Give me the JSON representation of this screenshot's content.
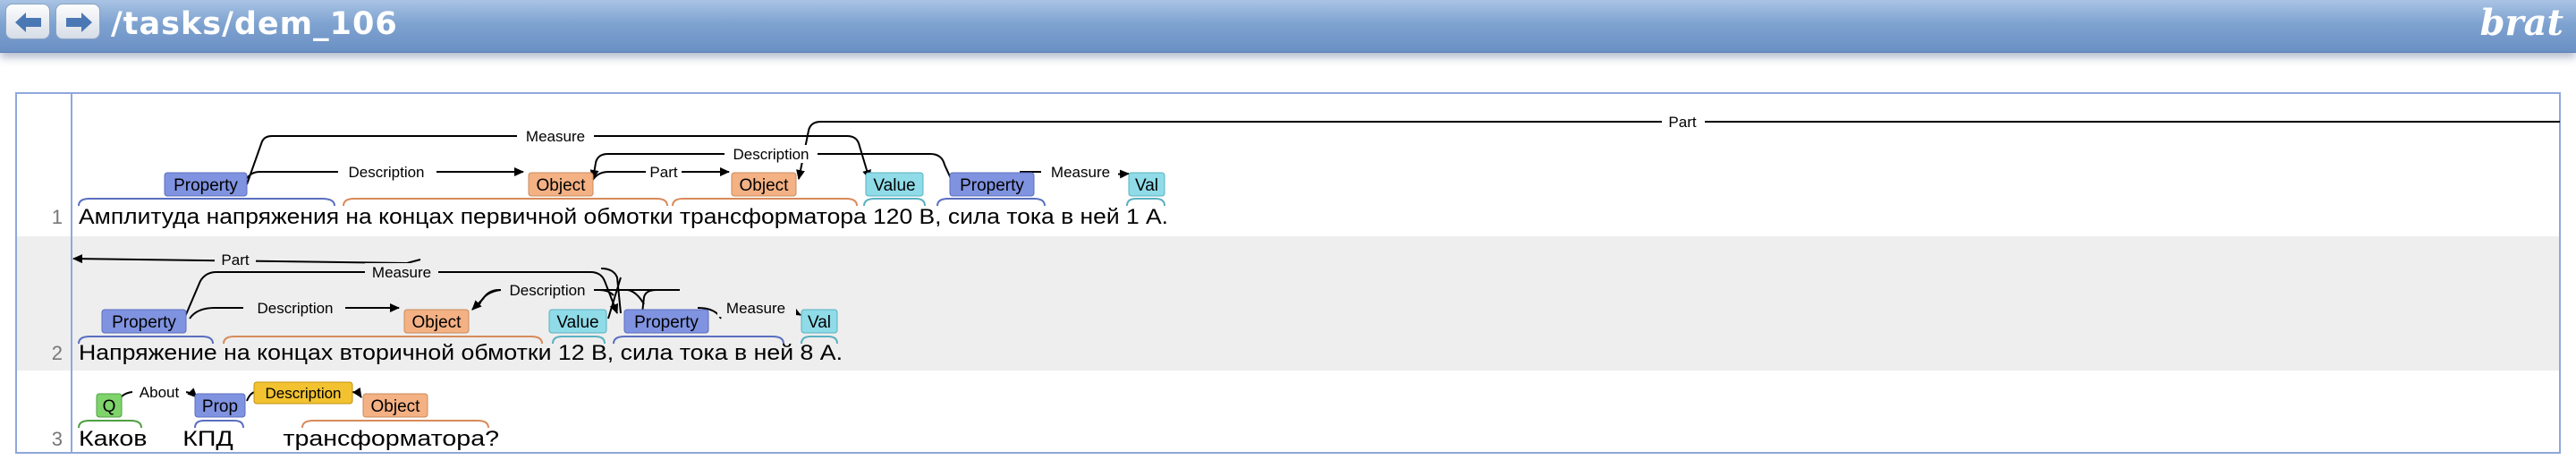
{
  "header": {
    "back_label": "",
    "forward_label": "",
    "doc_path": "/tasks/dem_106",
    "logo": "brat"
  },
  "sentences": [
    {
      "number": "1",
      "text": "Амплитуда напряжения на концах первичной обмотки трансформатора 120 В, сила тока в ней  1 А.",
      "entities": [
        {
          "type": "Property",
          "color": "#7f93e0",
          "covers": "Амплитуда напряжения"
        },
        {
          "type": "Object",
          "color": "#f4b183",
          "covers": "на концах первичной обмотки"
        },
        {
          "type": "Object",
          "color": "#f4b183",
          "covers": "трансформатора"
        },
        {
          "type": "Value",
          "color": "#8fdbe8",
          "covers": "120 В"
        },
        {
          "type": "Property",
          "color": "#7f93e0",
          "covers": "сила тока в ней"
        },
        {
          "type": "Val",
          "color": "#8fdbe8",
          "covers": "1 А"
        }
      ],
      "arcs": [
        "Measure",
        "Part",
        "Description",
        "Description",
        "Part",
        "Measure"
      ]
    },
    {
      "number": "2",
      "text": "Напряжение на концах вторичной обмотки  12 В, сила тока в ней   8 А.",
      "entities": [
        {
          "type": "Property",
          "color": "#7f93e0",
          "covers": "Напряжение"
        },
        {
          "type": "Object",
          "color": "#f4b183",
          "covers": "на концах вторичной обмотки"
        },
        {
          "type": "Value",
          "color": "#8fdbe8",
          "covers": "12 В"
        },
        {
          "type": "Property",
          "color": "#7f93e0",
          "covers": "сила тока в ней"
        },
        {
          "type": "Val",
          "color": "#8fdbe8",
          "covers": "8 А"
        }
      ],
      "arcs": [
        "Part",
        "Measure",
        "Description",
        "Description",
        "Measure"
      ]
    },
    {
      "number": "3",
      "text": "Каков     КПД       трансформатора?",
      "entities": [
        {
          "type": "Q",
          "color": "#7fd36b",
          "covers": "Каков"
        },
        {
          "type": "Prop",
          "color": "#7f93e0",
          "covers": "КПД"
        },
        {
          "type": "Object",
          "color": "#f4b183",
          "covers": "трансформатора?"
        }
      ],
      "arcs": [
        "About",
        "Description"
      ]
    }
  ],
  "colors": {
    "Property": "#7f93e0",
    "Object": "#f4b183",
    "Value": "#8fdbe8",
    "Q": "#7fd36b",
    "Description_highlight": "#f2c230"
  }
}
